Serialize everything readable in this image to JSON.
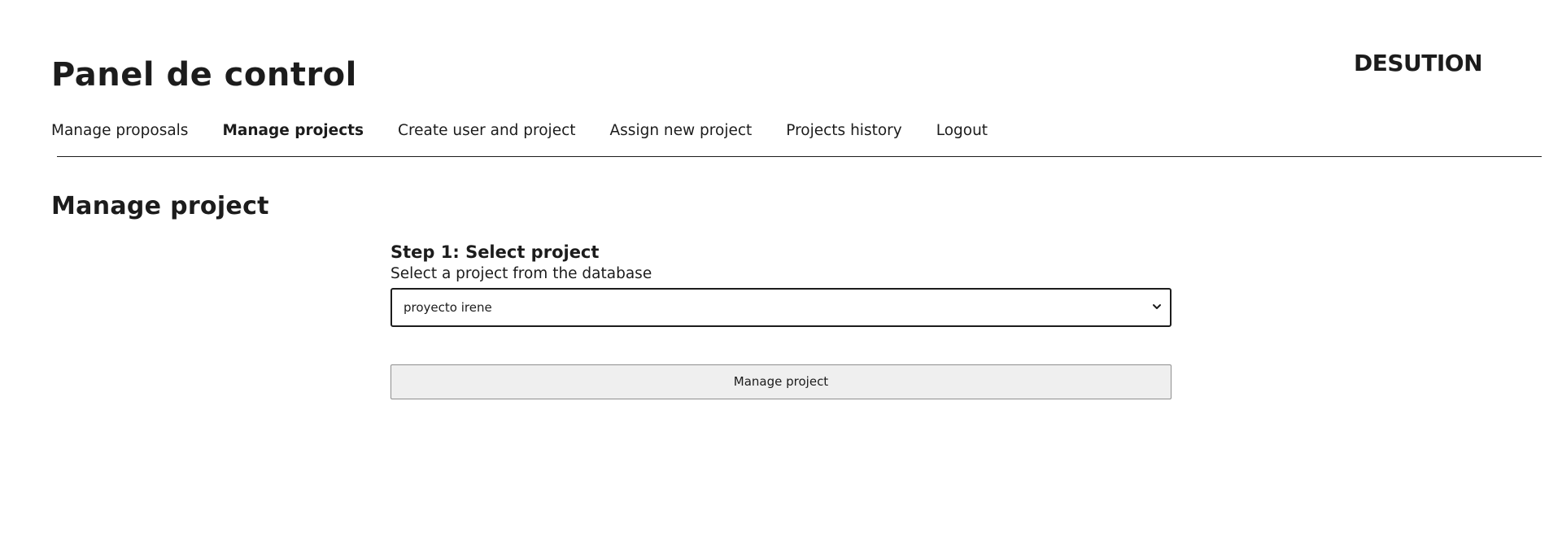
{
  "header": {
    "title": "Panel de control",
    "logo_text": "DESUTION"
  },
  "nav": {
    "items": [
      {
        "label": "Manage proposals",
        "active": false
      },
      {
        "label": "Manage projects",
        "active": true
      },
      {
        "label": "Create user and project",
        "active": false
      },
      {
        "label": "Assign new project",
        "active": false
      },
      {
        "label": "Projects history",
        "active": false
      },
      {
        "label": "Logout",
        "active": false
      }
    ]
  },
  "main": {
    "section_title": "Manage project",
    "step": {
      "title": "Step 1: Select project",
      "description": "Select a project from the database",
      "select": {
        "selected_value": "proyecto irene",
        "chevron_icon": "chevron-down-icon"
      },
      "button_label": "Manage project"
    }
  },
  "colors": {
    "text": "#1c1c1c",
    "background": "#ffffff",
    "button_bg": "#efefef",
    "button_border": "#8f8f8f"
  }
}
